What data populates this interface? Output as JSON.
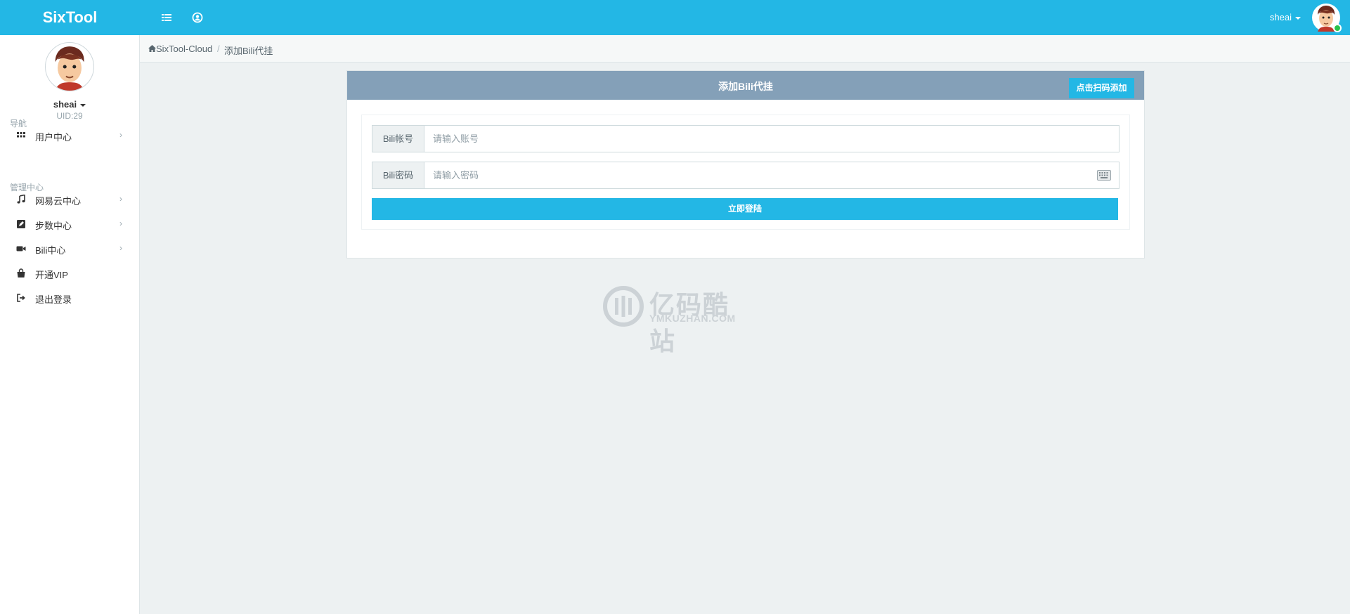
{
  "app": {
    "brand": "SixTool"
  },
  "topbar": {
    "username": "sheai"
  },
  "sidebar": {
    "username": "sheai",
    "uid": "UID:29",
    "nav_header": "导航",
    "manage_header": "管理中心",
    "items": [
      {
        "label": "用户中心",
        "icon": "grid-icon",
        "has_chevron": true
      },
      {
        "label": "网易云中心",
        "icon": "music-icon",
        "has_chevron": true
      },
      {
        "label": "步数中心",
        "icon": "edit-square-icon",
        "has_chevron": true
      },
      {
        "label": "Bili中心",
        "icon": "video-camera-icon",
        "has_chevron": true
      },
      {
        "label": "开通VIP",
        "icon": "shopping-bag-icon",
        "has_chevron": false
      },
      {
        "label": "退出登录",
        "icon": "sign-out-icon",
        "has_chevron": false
      }
    ],
    "chevron": "›"
  },
  "breadcrumb": {
    "home": "SixTool-Cloud",
    "separator": "/",
    "current": "添加Bili代挂"
  },
  "panel": {
    "title": "添加Bili代挂",
    "scan_button": "点击扫码添加",
    "account_label": "Bili帐号",
    "account_placeholder": "请输入账号",
    "password_label": "Bili密码",
    "password_placeholder": "请输入密码",
    "submit": "立即登陆"
  },
  "watermark": {
    "text": "亿码酷站",
    "domain": "YMKUZHAN.COM"
  },
  "colors": {
    "primary": "#23b7e5",
    "panel_header": "#84a0b8",
    "background": "#edf1f2"
  }
}
